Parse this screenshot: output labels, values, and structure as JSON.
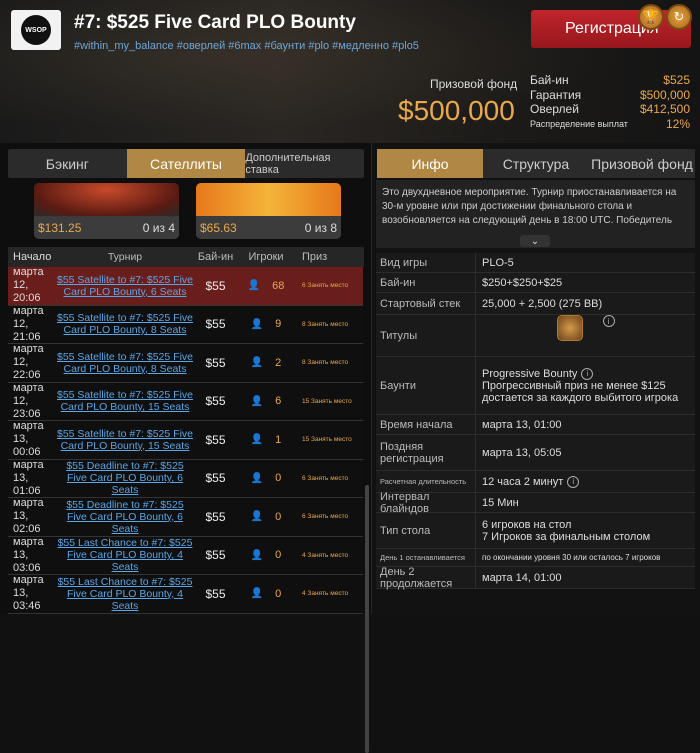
{
  "header": {
    "title": "#7: $525 Five Card PLO Bounty",
    "tags": "#within_my_balance #оверлей #6max #баунти #plo #медленно #plo5",
    "register_label": "Регистрация",
    "prize_label": "Призовой фонд",
    "prize_value": "$500,000",
    "info": [
      {
        "k": "Бай-ин",
        "v": "$525"
      },
      {
        "k": "Гарантия",
        "v": "$500,000"
      },
      {
        "k": "Оверлей",
        "v": "$412,500"
      },
      {
        "k": "Распределение выплат",
        "v": "12%"
      }
    ],
    "logo_text": "WSOP"
  },
  "left": {
    "tabs": [
      "Бэкинг",
      "Сателлиты",
      "Дополнительная ставка"
    ],
    "cards": [
      {
        "price": "$131.25",
        "count": "0 из 4"
      },
      {
        "price": "$65.63",
        "count": "0 из 8"
      }
    ],
    "columns": [
      "Начало",
      "Турнир",
      "Бай-ин",
      "Игроки",
      "Приз"
    ],
    "rows": [
      {
        "d1": "марта 12,",
        "d2": "20:06",
        "name": "$55 Satellite to #7: $525 Five Card PLO Bounty, 6 Seats",
        "buyin": "$55",
        "players": "68",
        "prize": "6 Занять место"
      },
      {
        "d1": "марта 12,",
        "d2": "21:06",
        "name": "$55 Satellite to #7: $525 Five Card PLO Bounty, 8 Seats",
        "buyin": "$55",
        "players": "9",
        "prize": "8 Занять место"
      },
      {
        "d1": "марта 12,",
        "d2": "22:06",
        "name": "$55 Satellite to #7: $525 Five Card PLO Bounty, 8 Seats",
        "buyin": "$55",
        "players": "2",
        "prize": "8 Занять место"
      },
      {
        "d1": "марта 12,",
        "d2": "23:06",
        "name": "$55 Satellite to #7: $525 Five Card PLO Bounty, 15 Seats",
        "buyin": "$55",
        "players": "6",
        "prize": "15 Занять место"
      },
      {
        "d1": "марта 13,",
        "d2": "00:06",
        "name": "$55 Satellite to #7: $525 Five Card PLO Bounty, 15 Seats",
        "buyin": "$55",
        "players": "1",
        "prize": "15 Занять место"
      },
      {
        "d1": "марта 13,",
        "d2": "01:06",
        "name": "$55 Deadline to #7: $525 Five Card PLO Bounty, 6 Seats",
        "buyin": "$55",
        "players": "0",
        "prize": "6 Занять место"
      },
      {
        "d1": "марта 13,",
        "d2": "02:06",
        "name": "$55 Deadline to #7: $525 Five Card PLO Bounty, 6 Seats",
        "buyin": "$55",
        "players": "0",
        "prize": "6 Занять место"
      },
      {
        "d1": "марта 13,",
        "d2": "03:06",
        "name": "$55 Last Chance to #7: $525 Five Card PLO Bounty, 4 Seats",
        "buyin": "$55",
        "players": "0",
        "prize": "4 Занять место"
      },
      {
        "d1": "марта 13,",
        "d2": "03:46",
        "name": "$55 Last Chance to #7: $525 Five Card PLO Bounty, 4 Seats",
        "buyin": "$55",
        "players": "0",
        "prize": "4 Занять место"
      }
    ]
  },
  "right": {
    "tabs": [
      "Инфо",
      "Структура",
      "Призовой фонд"
    ],
    "description": "Это двухдневное мероприятие. Турнир приостанавливается на 30-м уровне или при достижении финального стола и возобновляется на следующий день в 18:00 UTC. Победитель",
    "details": [
      {
        "k": "Вид игры",
        "v": "PLO-5"
      },
      {
        "k": "Бай-ин",
        "v": "$250+$250+$25"
      },
      {
        "k": "Стартовый стек",
        "v": "25,000 + 2,500 (275 BB)"
      },
      {
        "k": "Титулы",
        "v": ""
      },
      {
        "k": "Баунти",
        "v": "Progressive Bounty",
        "v2": "Прогрессивный приз не менее $125 достается за каждого выбитого игрока"
      },
      {
        "k": "Время начала",
        "v": "марта 13, 01:00"
      },
      {
        "k": "Поздняя регистрация",
        "v": "марта 13, 05:05"
      },
      {
        "k": "Расчетная длительность",
        "v": "12 часа 2 минут"
      },
      {
        "k": "Интервал блайндов",
        "v": "15 Мин"
      },
      {
        "k": "Тип стола",
        "v": "6 игроков на стол",
        "v2": "7 Игроков за финальным столом"
      },
      {
        "k": "День 1 останавливается",
        "v": "по окончании уровня 30 или осталось 7 игроков"
      },
      {
        "k": "День 2 продолжается",
        "v": "марта 14, 01:00"
      }
    ]
  }
}
